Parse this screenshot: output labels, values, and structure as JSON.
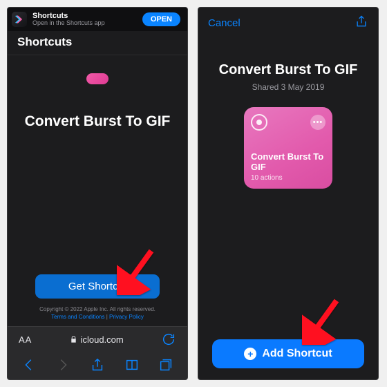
{
  "left": {
    "banner": {
      "title": "Shortcuts",
      "subtitle": "Open in the Shortcuts app",
      "open": "OPEN"
    },
    "header": "Shortcuts",
    "title": "Convert Burst To GIF",
    "getButton": "Get Shortcut",
    "copyright": "Copyright © 2022 Apple Inc. All rights reserved.",
    "terms": "Terms and Conditions",
    "privacy": "Privacy Policy",
    "aa": "AA",
    "url": "icloud.com"
  },
  "right": {
    "cancel": "Cancel",
    "title": "Convert Burst To GIF",
    "shared": "Shared 3 May 2019",
    "card": {
      "name": "Convert Burst To GIF",
      "meta": "10 actions"
    },
    "addButton": "Add Shortcut"
  }
}
